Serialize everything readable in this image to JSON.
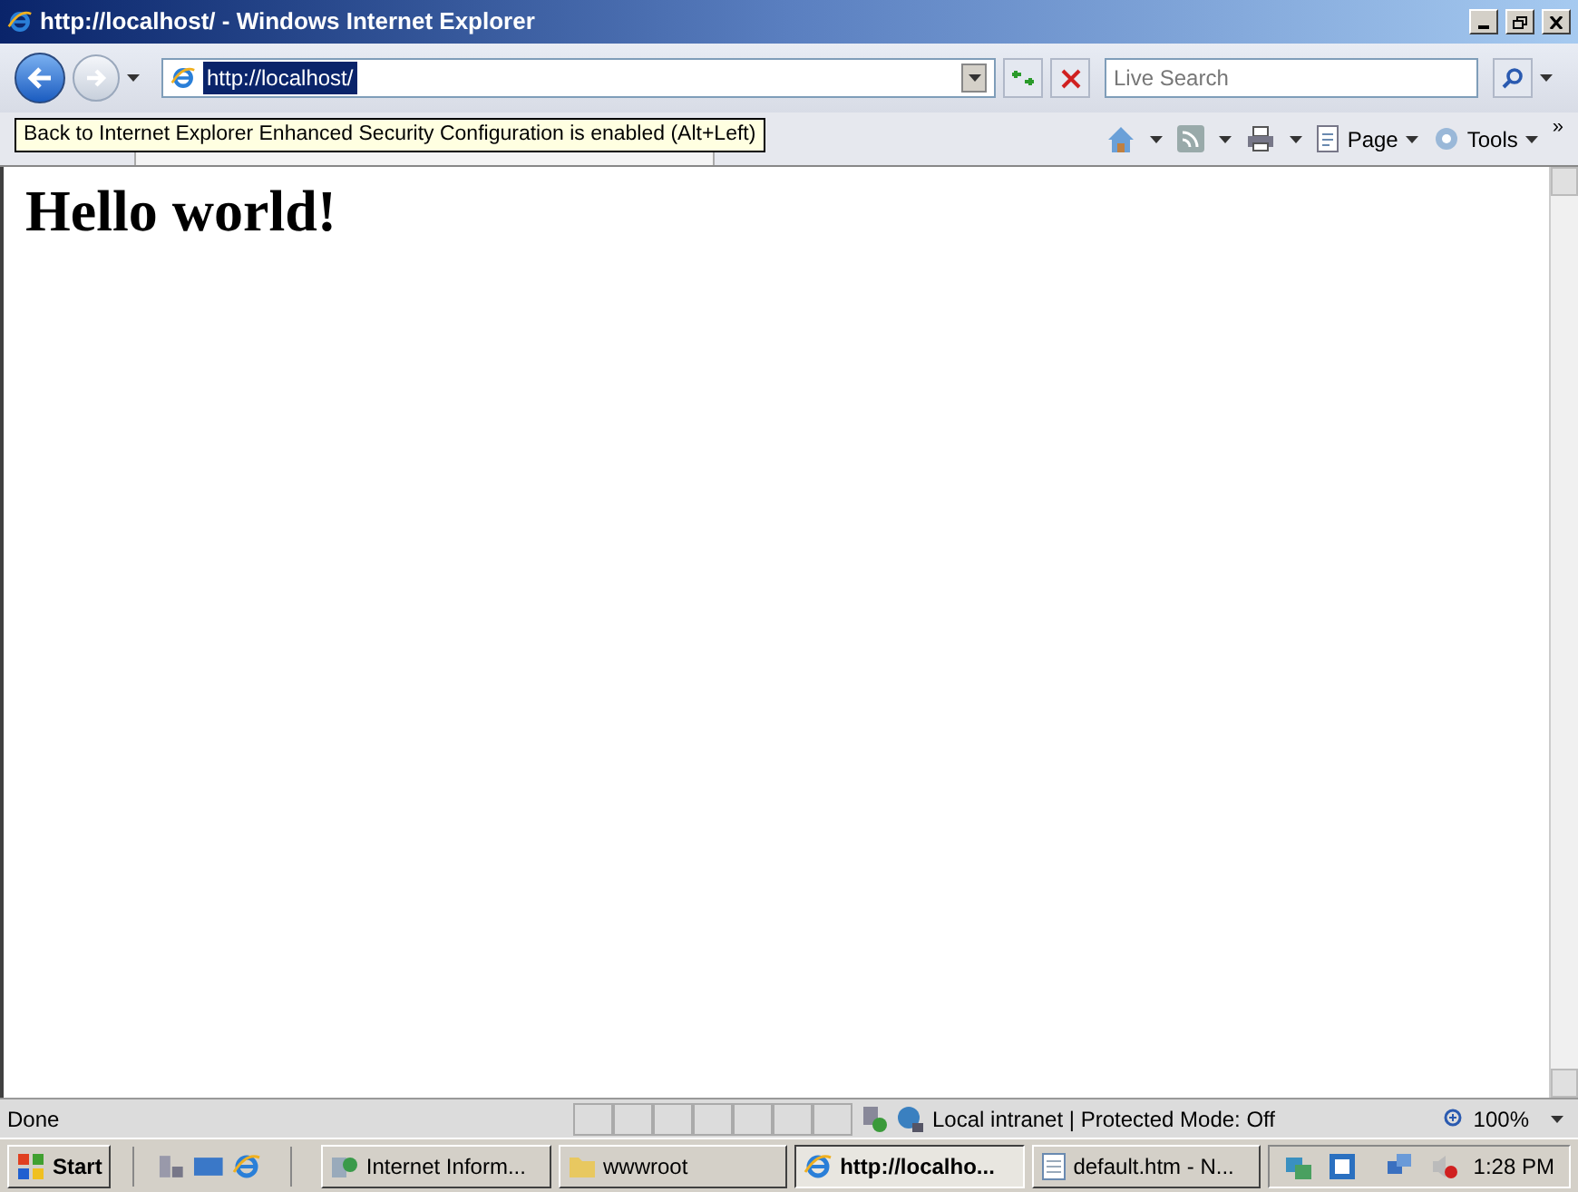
{
  "window": {
    "title": "http://localhost/ - Windows Internet Explorer"
  },
  "address_bar": {
    "url": "http://localhost/"
  },
  "search": {
    "placeholder": "Live Search"
  },
  "command_bar": {
    "items": [
      {
        "label": "Page"
      },
      {
        "label": "Tools"
      }
    ],
    "overflow": "»"
  },
  "tooltip": {
    "text": "Back to Internet Explorer Enhanced Security Configuration is enabled (Alt+Left)"
  },
  "page": {
    "heading": "Hello world!"
  },
  "status_bar": {
    "text": "Done",
    "zone": "Local intranet | Protected Mode: Off",
    "zoom": "100%"
  },
  "taskbar": {
    "start": "Start",
    "tasks": [
      {
        "label": "Internet Inform...",
        "kind": "iis",
        "selected": false
      },
      {
        "label": "wwwroot",
        "kind": "folder",
        "selected": false
      },
      {
        "label": "http://localho...",
        "kind": "ie",
        "selected": true
      },
      {
        "label": "default.htm - N...",
        "kind": "notepad",
        "selected": false
      }
    ],
    "clock": "1:28 PM"
  }
}
